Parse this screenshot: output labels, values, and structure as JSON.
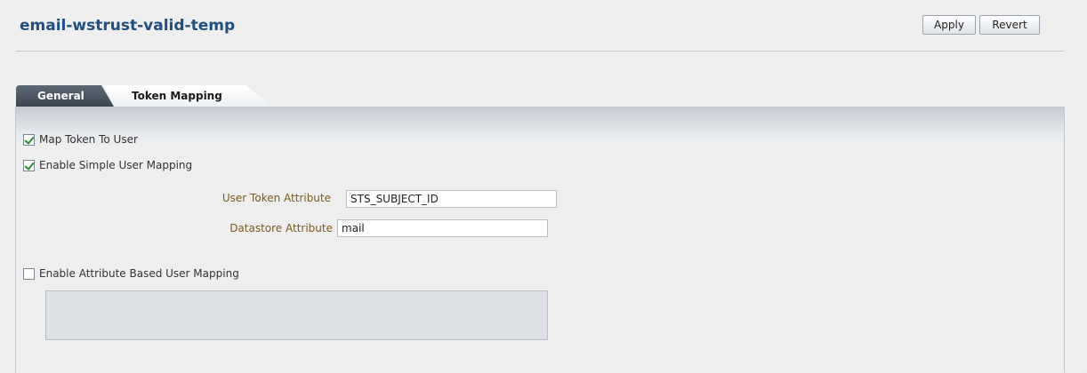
{
  "header": {
    "title": "email-wstrust-valid-temp",
    "apply_label": "Apply",
    "revert_label": "Revert"
  },
  "tabs": [
    {
      "label": "General",
      "selected": false
    },
    {
      "label": "Token Mapping",
      "selected": true
    }
  ],
  "form": {
    "map_token_to_user": {
      "label": "Map Token To User",
      "checked": true
    },
    "enable_simple_user_mapping": {
      "label": "Enable Simple User Mapping",
      "checked": true
    },
    "user_token_attribute": {
      "label": "User Token Attribute",
      "value": "STS_SUBJECT_ID"
    },
    "datastore_attribute": {
      "label": "Datastore Attribute",
      "value": "mail"
    },
    "enable_attribute_based_user_mapping": {
      "label": "Enable Attribute Based User Mapping",
      "checked": false
    }
  },
  "colors": {
    "title": "#1f4f80",
    "field_label": "#7a5a1e",
    "check": "#2f8a2f",
    "tab_active_bg": "#ffffff",
    "tab_inactive_bg": "#4a5560"
  }
}
